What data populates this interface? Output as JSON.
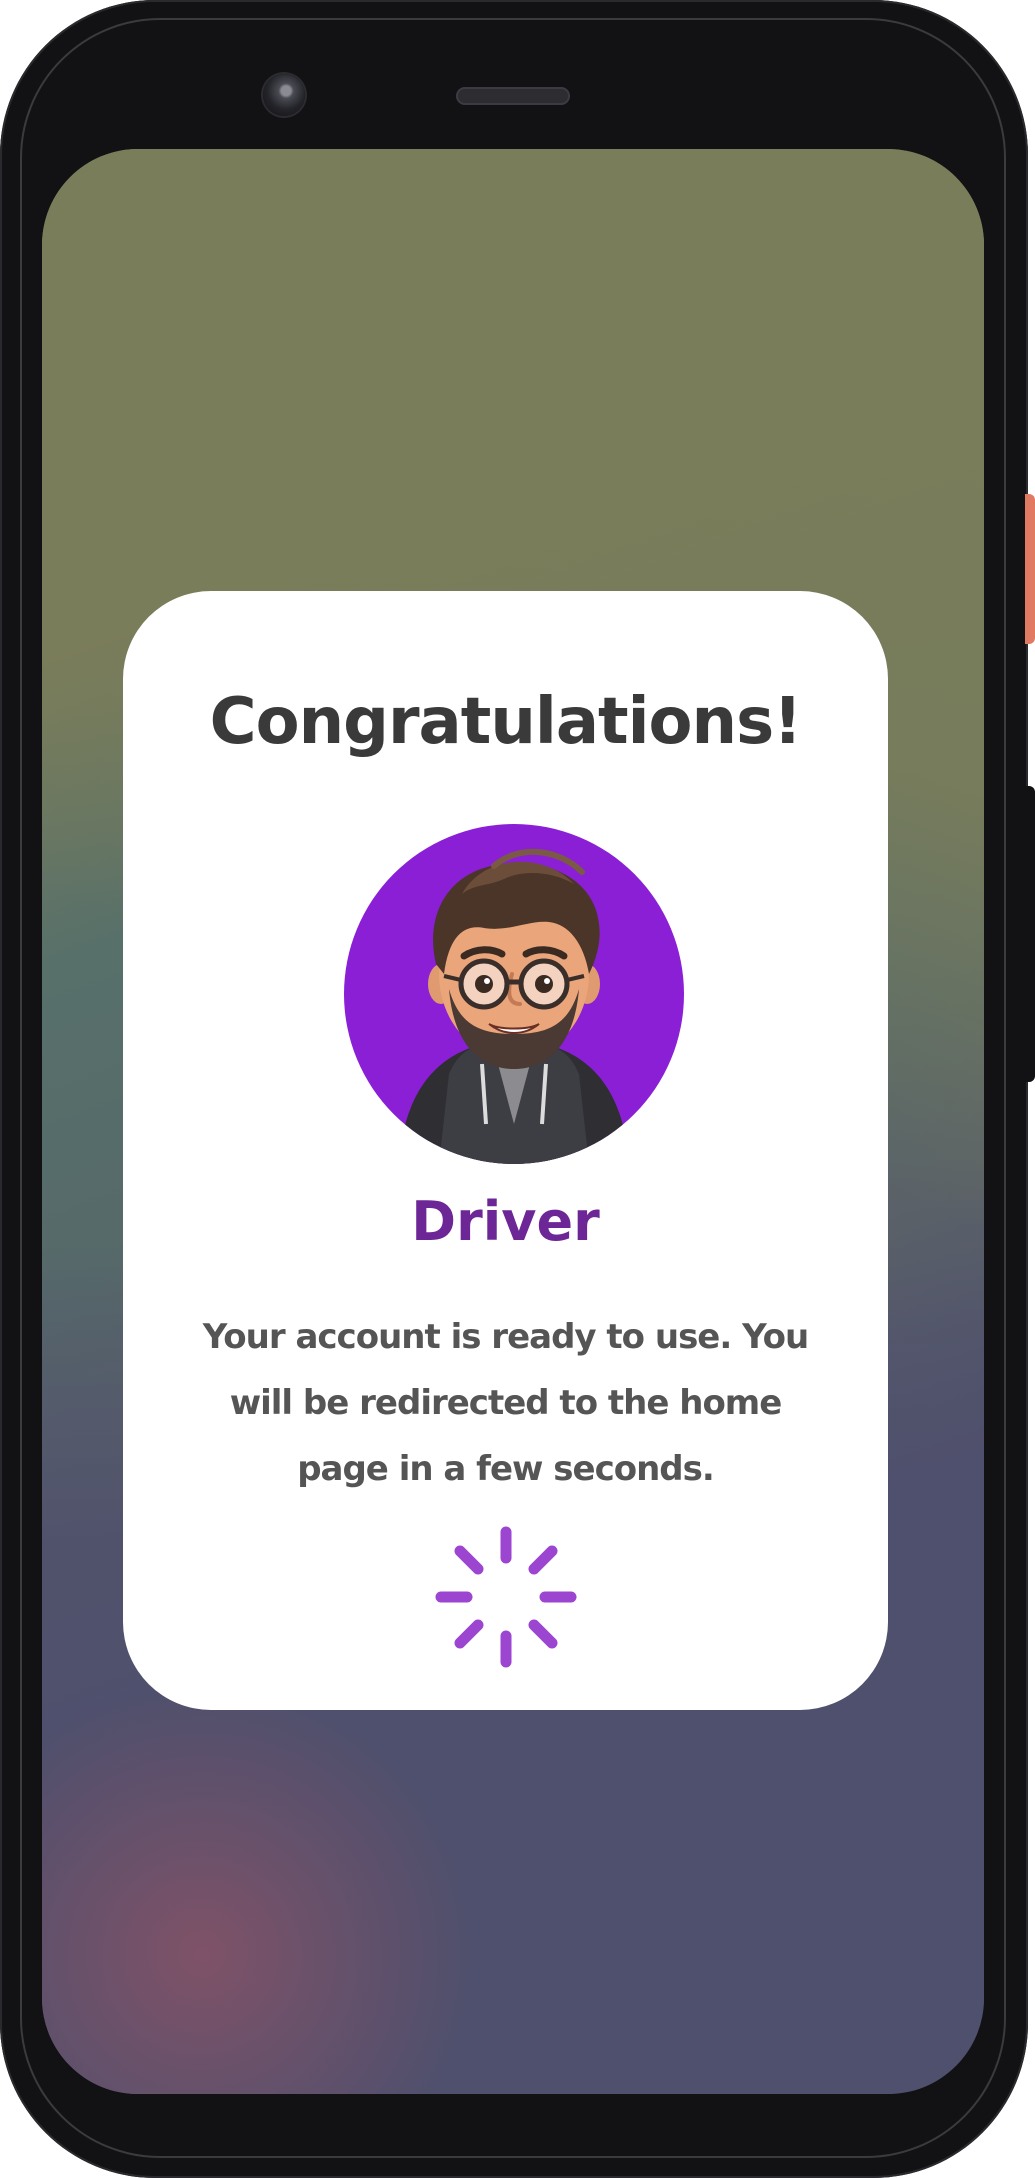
{
  "dialog": {
    "title": "Congratulations!",
    "role": "Driver",
    "message": "Your account is ready to use. You will be redirected to the home page in a few seconds."
  },
  "avatar": {
    "icon": "avatar-illustration",
    "background_color": "#8a1fd6"
  },
  "spinner": {
    "icon": "loading-spinner-icon",
    "color": "#9b45d0"
  },
  "colors": {
    "card_background": "#ffffff",
    "title_text": "#3a3a3a",
    "role_text": "#6d2696",
    "message_text": "#555555"
  }
}
